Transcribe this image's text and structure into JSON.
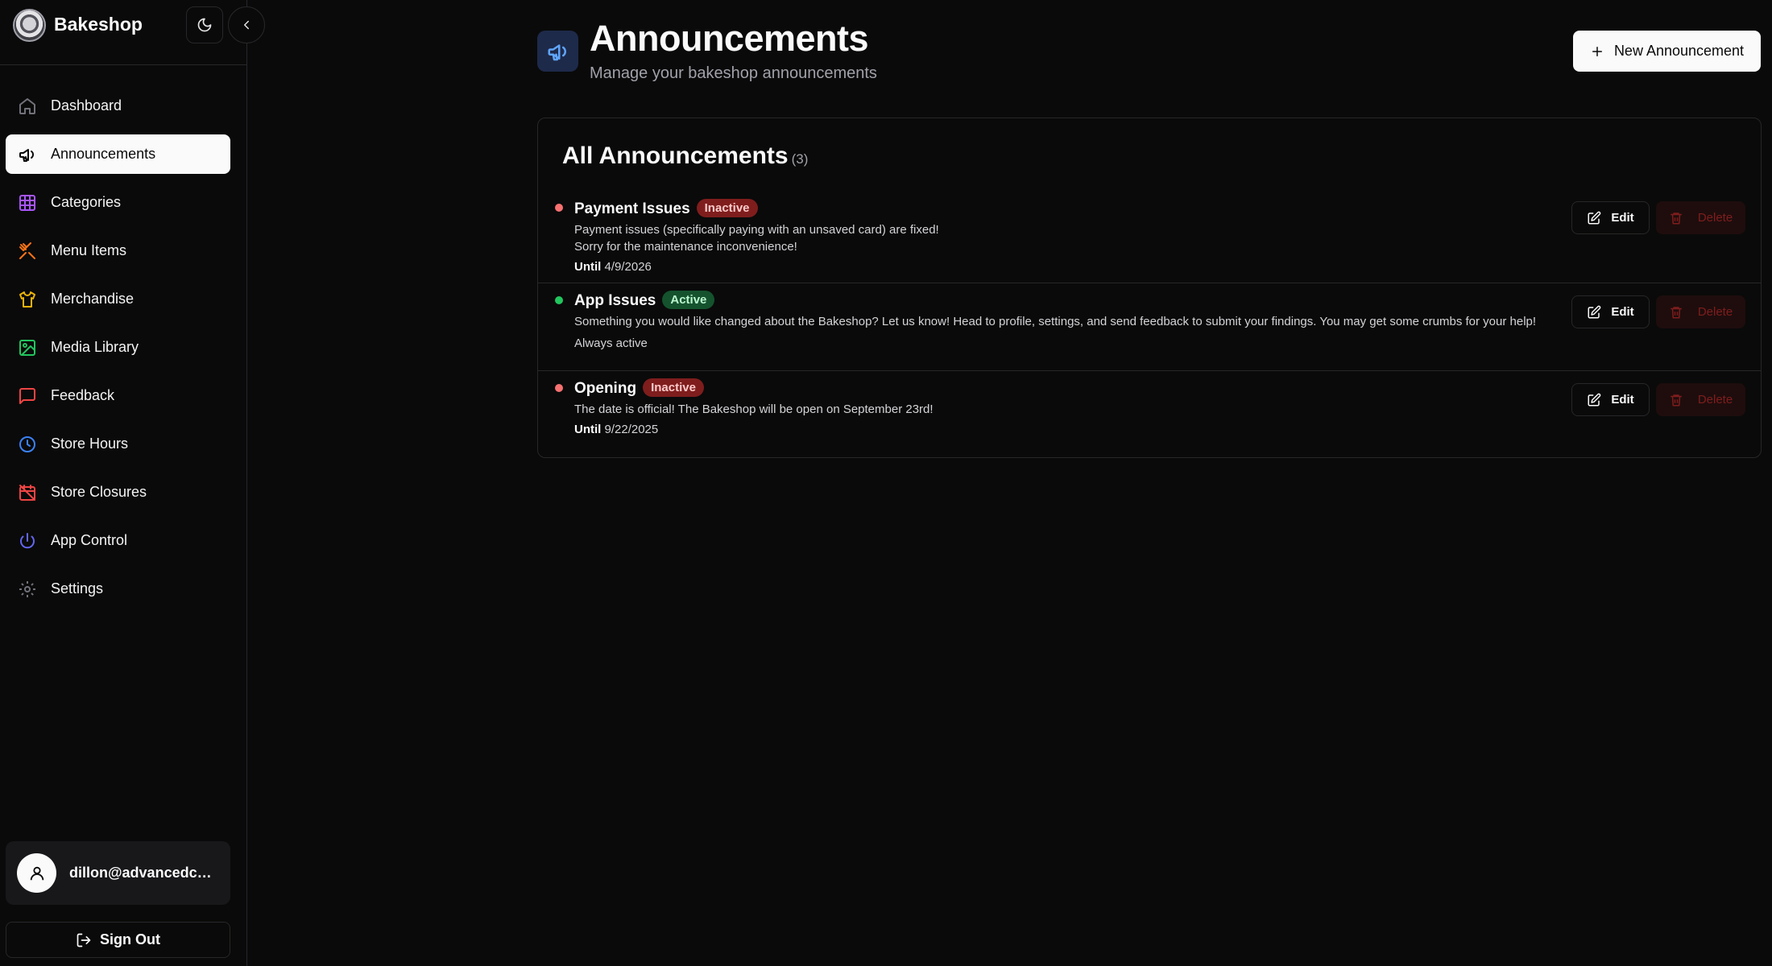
{
  "app": {
    "brand": "Bakeshop"
  },
  "sidebar": {
    "items": [
      {
        "label": "Dashboard",
        "icon": "home-icon",
        "color": "#71717a"
      },
      {
        "label": "Announcements",
        "icon": "megaphone-icon",
        "color": "#0a0a0a",
        "active": true
      },
      {
        "label": "Categories",
        "icon": "grid-icon",
        "color": "#a855f7"
      },
      {
        "label": "Menu Items",
        "icon": "utensils-icon",
        "color": "#f97316"
      },
      {
        "label": "Merchandise",
        "icon": "shirt-icon",
        "color": "#eab308"
      },
      {
        "label": "Media Library",
        "icon": "image-icon",
        "color": "#22c55e"
      },
      {
        "label": "Feedback",
        "icon": "message-icon",
        "color": "#ef4444"
      },
      {
        "label": "Store Hours",
        "icon": "clock-icon",
        "color": "#3b82f6"
      },
      {
        "label": "Store Closures",
        "icon": "calendar-off-icon",
        "color": "#ef4444"
      },
      {
        "label": "App Control",
        "icon": "power-icon",
        "color": "#6366f1"
      },
      {
        "label": "Settings",
        "icon": "gear-icon",
        "color": "#71717a"
      }
    ],
    "user_email": "dillon@advancedcsll...",
    "sign_out": "Sign Out"
  },
  "header": {
    "title": "Announcements",
    "subtitle": "Manage your bakeshop announcements",
    "new_button": "New Announcement"
  },
  "list": {
    "title": "All Announcements",
    "count": "(3)",
    "edit_label": "Edit",
    "delete_label": "Delete",
    "until_label": "Until",
    "items": [
      {
        "title": "Payment Issues",
        "status": "Inactive",
        "body1": "Payment issues (specifically paying with an unsaved card) are fixed!",
        "body2": "Sorry for the maintenance inconvenience!",
        "date": "4/9/2026"
      },
      {
        "title": "App Issues",
        "status": "Active",
        "body1": "Something you would like changed about the Bakeshop? Let us know! Head to profile, settings, and send feedback to submit your findings. You may get some crumbs for your help!",
        "meta": "Always active"
      },
      {
        "title": "Opening",
        "status": "Inactive",
        "body1": "The date is official! The Bakeshop will be open on September 23rd!",
        "date": "9/22/2025"
      }
    ]
  }
}
